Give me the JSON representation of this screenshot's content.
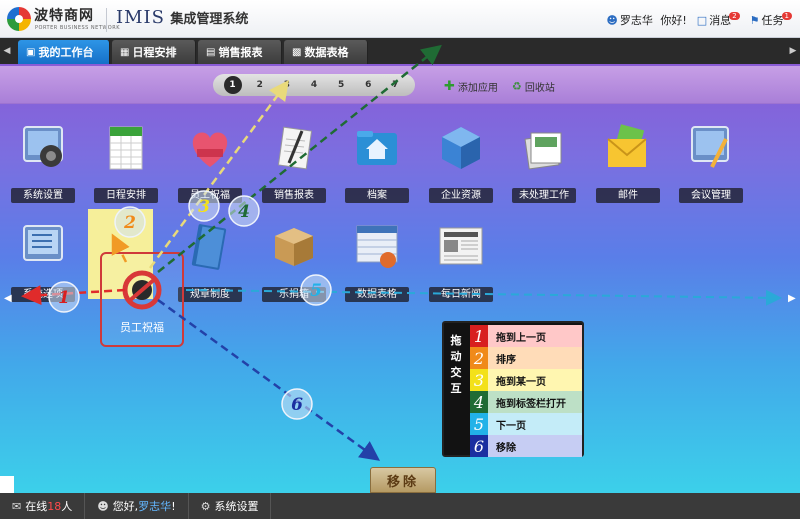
{
  "header": {
    "brand": "波特商网",
    "brand_sub": "PORTER BUSINESS NETWORK",
    "sys_prefix": "IMIS",
    "sys_name": "集成管理系统",
    "user_name": "罗志华",
    "greeting": "你好!",
    "messages_label": "消息",
    "messages_count": "2",
    "tasks_label": "任务",
    "tasks_count": "1"
  },
  "tabs": [
    {
      "label": "我的工作台"
    },
    {
      "label": "日程安排"
    },
    {
      "label": "销售报表"
    },
    {
      "label": "数据表格"
    }
  ],
  "pager": {
    "pages": [
      "1",
      "2",
      "3",
      "4",
      "5",
      "6",
      "7"
    ],
    "active": "1"
  },
  "strip": {
    "add_app": "添加应用",
    "recycle": "回收站"
  },
  "apps_row1": [
    {
      "label": "系统设置",
      "icon": "gear-icon"
    },
    {
      "label": "日程安排",
      "icon": "calendar-icon"
    },
    {
      "label": "员工祝福",
      "icon": "heart-gift-icon"
    },
    {
      "label": "销售报表",
      "icon": "notebook-icon"
    },
    {
      "label": "档案",
      "icon": "folder-home-icon"
    },
    {
      "label": "企业资源",
      "icon": "cube-icon"
    },
    {
      "label": "未处理工作",
      "icon": "stack-icon"
    },
    {
      "label": "邮件",
      "icon": "mail-icon"
    },
    {
      "label": "会议管理",
      "icon": "meeting-icon"
    }
  ],
  "apps_row2": [
    {
      "label": "系统选项",
      "icon": "list-icon"
    },
    {
      "label": "规章制度",
      "icon": "book-icon"
    },
    {
      "label": "乐捐箱",
      "icon": "box-icon"
    },
    {
      "label": "数据表格",
      "icon": "table-icon"
    },
    {
      "label": "每日新闻",
      "icon": "newspaper-icon"
    }
  ],
  "dragging": {
    "label": "员工祝福"
  },
  "remove_zone": "移除",
  "legend": {
    "title": "拖动交互",
    "items": [
      {
        "num": "1",
        "text": "拖到上一页",
        "num_color": "#d81f1f",
        "bg": "#ffc8c8"
      },
      {
        "num": "2",
        "text": "排序",
        "num_color": "#f08a1a",
        "bg": "#ffdcb8"
      },
      {
        "num": "3",
        "text": "拖到某一页",
        "num_color": "#f3e11a",
        "bg": "#fff6b0"
      },
      {
        "num": "4",
        "text": "拖到标签栏打开",
        "num_color": "#1f6b34",
        "bg": "#bde0c6"
      },
      {
        "num": "5",
        "text": "下一页",
        "num_color": "#22b2e8",
        "bg": "#c4ecf8"
      },
      {
        "num": "6",
        "text": "移除",
        "num_color": "#1b2fa0",
        "bg": "#c6cdf3"
      }
    ]
  },
  "footer": {
    "online_prefix": "在线",
    "online_count": "18",
    "online_suffix": "人",
    "hello": "您好,",
    "user": "罗志华",
    "exclaim": "!",
    "settings": "系统设置"
  }
}
